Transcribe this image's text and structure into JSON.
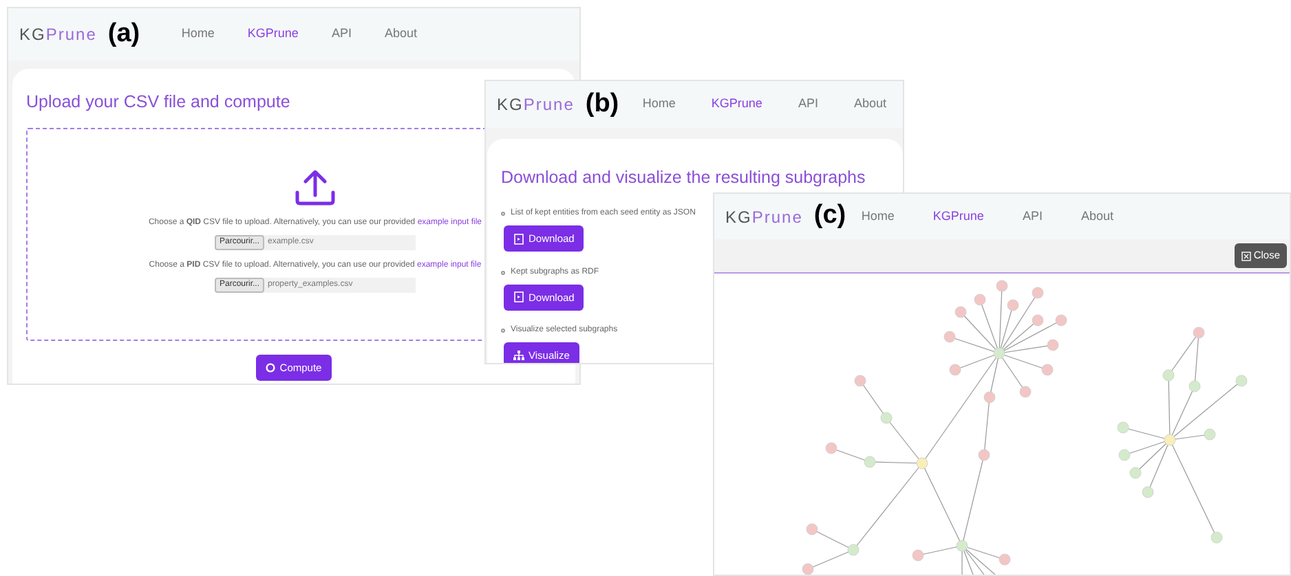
{
  "panels": [
    {
      "kind": "upload",
      "label": "(a)",
      "brand": {
        "prefix": "KG",
        "suffix": "Prune"
      },
      "nav": [
        {
          "label": "Home",
          "selected": false
        },
        {
          "label": "KGPrune",
          "selected": true
        },
        {
          "label": "API",
          "selected": false
        },
        {
          "label": "About",
          "selected": false
        }
      ],
      "title": "Upload your CSV file and compute",
      "uploads": [
        {
          "text": "Choose a **QID** CSV file to upload. Alternatively, you can use our provided",
          "link": "example input file",
          "browse": "Parcourir...",
          "file": "example.csv"
        },
        {
          "text": "Choose a **PID** CSV file to upload. Alternatively, you can use our provided",
          "link": "example input file",
          "browse": "Parcourir...",
          "file": "property_examples.csv"
        }
      ],
      "button": "Compute"
    },
    {
      "kind": "download",
      "label": "(b)",
      "brand": {
        "prefix": "KG",
        "suffix": "Prune"
      },
      "nav": [
        {
          "label": "Home",
          "selected": false
        },
        {
          "label": "KGPrune",
          "selected": true
        },
        {
          "label": "API",
          "selected": false
        },
        {
          "label": "About",
          "selected": false
        }
      ],
      "title": "Download and visualize the resulting subgraphs",
      "items": [
        {
          "text": "List of kept entities from each seed entity as JSON",
          "button": "Download",
          "kind": "download"
        },
        {
          "text": "Kept subgraphs as RDF",
          "button": "Download",
          "kind": "download"
        },
        {
          "text": "Visualize selected subgraphs",
          "button": "Visualize",
          "kind": "visualize"
        }
      ]
    },
    {
      "kind": "graph",
      "label": "(c)",
      "brand": {
        "prefix": "KG",
        "suffix": "Prune"
      },
      "nav": [
        {
          "label": "Home",
          "selected": false
        },
        {
          "label": "KGPrune",
          "selected": true
        },
        {
          "label": "API",
          "selected": false
        },
        {
          "label": "About",
          "selected": false
        }
      ],
      "button": "Close"
    }
  ]
}
